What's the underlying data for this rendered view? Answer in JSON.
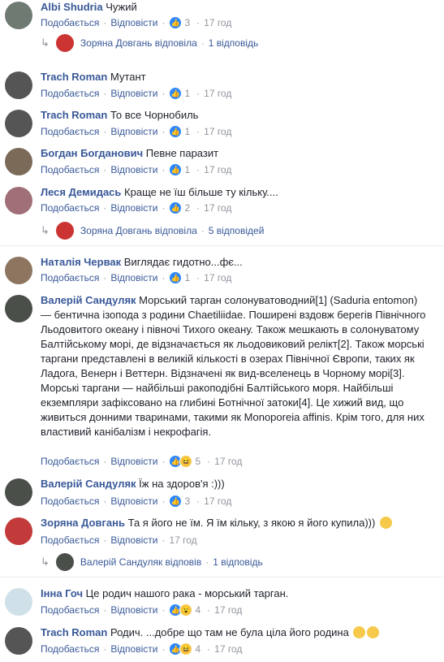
{
  "labels": {
    "like": "Подобається",
    "reply": "Відповісти",
    "dot": "·"
  },
  "colors": {
    "author": "#385898",
    "meta": "#90949c",
    "like_icon": "#2d88ff",
    "haha_icon": "#f7c94a"
  },
  "comments": [
    {
      "author": "Albi Shudria",
      "text": "Чужий",
      "reactions": "3",
      "time": "17 год"
    },
    {
      "author": "Trach Roman",
      "text": "Мутант",
      "reactions": "1",
      "time": "17 год"
    },
    {
      "author": "Trach Roman",
      "text": "То все Чорнобиль",
      "reactions": "1",
      "time": "17 год"
    },
    {
      "author": "Богдан Богданович",
      "text": "Певне паразит",
      "reactions": "1",
      "time": "17 год"
    },
    {
      "author": "Леся Демидась",
      "text": "Краще не їш більше ту кільку....",
      "reactions": "2",
      "time": "17 год"
    },
    {
      "author": "Наталія Червак",
      "text": "Виглядає гидотно...фє...",
      "reactions": "1",
      "time": "17 год"
    },
    {
      "author": "Валерій Сандуляк",
      "text": "Морський тарган солонуватоводний[1] (Saduria entomon) — бентична ізопода з родини Chaetiliidae. Поширені вздовж берегів Північного Льодовитого океану і півночі Тихого океану. Також мешкають в солонуватому Балтійському морі, де відзначається як льодовиковий релікт[2]. Також морські таргани представлені в великій кількості в озерах Північної Європи, таких як Ладога, Венерн і Веттерн. Відзначені як вид-вселенець в Чорному морі[3].",
      "text2": "Морські таргани — найбільші ракоподібні Балтійського моря. Найбільші екземпляри зафіксовано на глибині Ботнічної затоки[4]. Це хижий вид, що живиться донними тваринами, такими як Monoporeia affinis. Крім того, для них властивий канібалізм і некрофагія.",
      "reactions": "5",
      "time": "17 год"
    },
    {
      "author": "Валерій Сандуляк",
      "text": "Їж на здоров'я :)))",
      "reactions": "3",
      "time": "17 год"
    },
    {
      "author": "Зоряна Довгань",
      "text": "Та я його не їм. Я їм кільку, з якою я його купила)))",
      "time": "17 год"
    },
    {
      "author": "Інна Гоч",
      "text": "Це родич нашого рака - морський тарган.",
      "reactions": "4",
      "time": "17 год"
    },
    {
      "author": "Trach Roman",
      "text": "Родич. ...добре що там не була ціла його родина",
      "reactions": "4",
      "time": "17 год"
    }
  ],
  "replies": [
    {
      "text": "Зоряна Довгань відповіла",
      "count": "1 відповідь"
    },
    {
      "text": "Зоряна Довгань відповіла",
      "count": "5 відповідей"
    },
    {
      "text": "Валерій Сандуляк відповів",
      "count": "1 відповідь"
    }
  ]
}
